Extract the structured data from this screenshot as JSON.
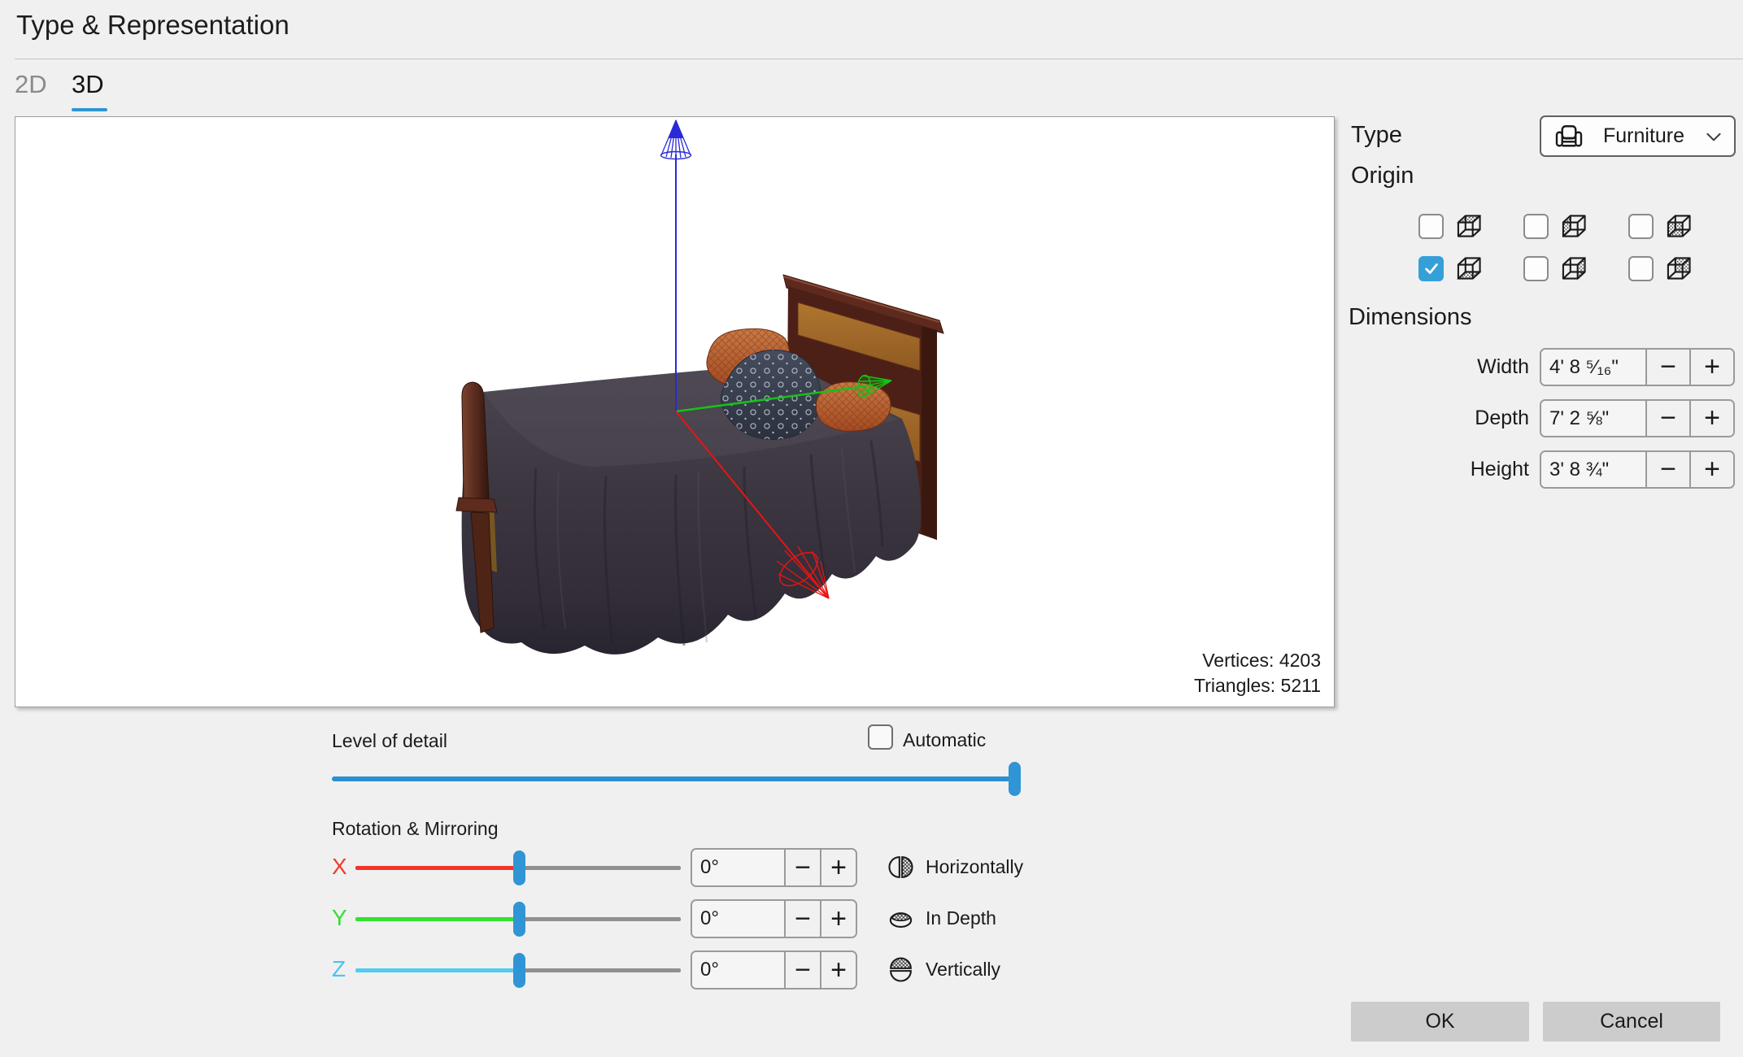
{
  "header": {
    "title": "Type & Representation",
    "tabs": [
      {
        "label": "2D",
        "active": false
      },
      {
        "label": "3D",
        "active": true
      }
    ]
  },
  "viewport": {
    "model": "bed",
    "stats": [
      {
        "label": "Vertices: 4203"
      },
      {
        "label": "Triangles: 5211"
      }
    ]
  },
  "panel": {
    "type": {
      "label": "Type",
      "value": "Furniture"
    },
    "origin": {
      "label": "Origin",
      "options": [
        {
          "face": "top",
          "checked": false
        },
        {
          "face": "left",
          "checked": false
        },
        {
          "face": "front",
          "checked": false
        },
        {
          "face": "bottom",
          "checked": true
        },
        {
          "face": "right",
          "checked": false
        },
        {
          "face": "back",
          "checked": false
        }
      ]
    },
    "dimensions": {
      "label": "Dimensions",
      "fields": [
        {
          "label": "Width",
          "value": "4' 8 ⁵⁄₁₆\""
        },
        {
          "label": "Depth",
          "value": "7' 2 ⅝\""
        },
        {
          "label": "Height",
          "value": "3' 8 ¾\""
        }
      ]
    }
  },
  "stepper": {
    "minus": "−",
    "plus": "+"
  },
  "level_of_detail": {
    "label": "Level of detail",
    "automatic": {
      "label": "Automatic",
      "checked": false
    },
    "percent": 100
  },
  "rotation": {
    "label": "Rotation & Mirroring",
    "axes": [
      {
        "label": "X",
        "value": "0°",
        "color": "#f23428"
      },
      {
        "label": "Y",
        "value": "0°",
        "color": "#35e030"
      },
      {
        "label": "Z",
        "value": "0°",
        "color": "#53cbf5"
      }
    ],
    "mirror": [
      {
        "label": "Horizontally"
      },
      {
        "label": "In Depth"
      },
      {
        "label": "Vertically"
      }
    ]
  },
  "footer": {
    "ok_label": "OK",
    "cancel_label": "Cancel"
  },
  "colors": {
    "accent_blue": "#3095d5",
    "checkbox_blue": "#35a0d8",
    "axis_x_red": "#f23428",
    "axis_y_green": "#35e030",
    "axis_z_cyan": "#53cbf5",
    "scene_axis_blue": "#2a2ad8",
    "scene_axis_green": "#16c216",
    "scene_axis_red": "#e81414"
  }
}
